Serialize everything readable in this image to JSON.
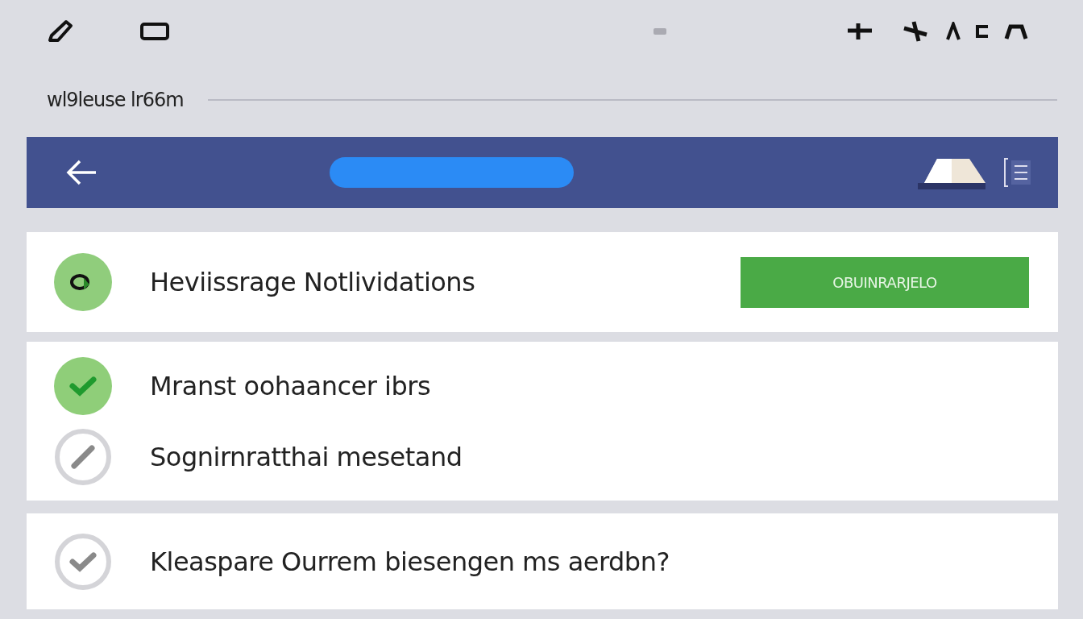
{
  "page_title": "wl9leuse lr66m",
  "notification_card": {
    "title": "Heviissrage Notlividations",
    "button": "OBUINRARJELO"
  },
  "groups": [
    {
      "items": [
        {
          "label": "Mranst oohaancer ibrs",
          "kind": "check",
          "checked": true
        },
        {
          "label": "Sognirnratthai mesetand",
          "kind": "slash",
          "checked": false
        }
      ]
    },
    {
      "items": [
        {
          "label": "Kleaspare Ourrem biesengen ms aerdbn?",
          "kind": "check",
          "checked": false
        }
      ]
    }
  ]
}
